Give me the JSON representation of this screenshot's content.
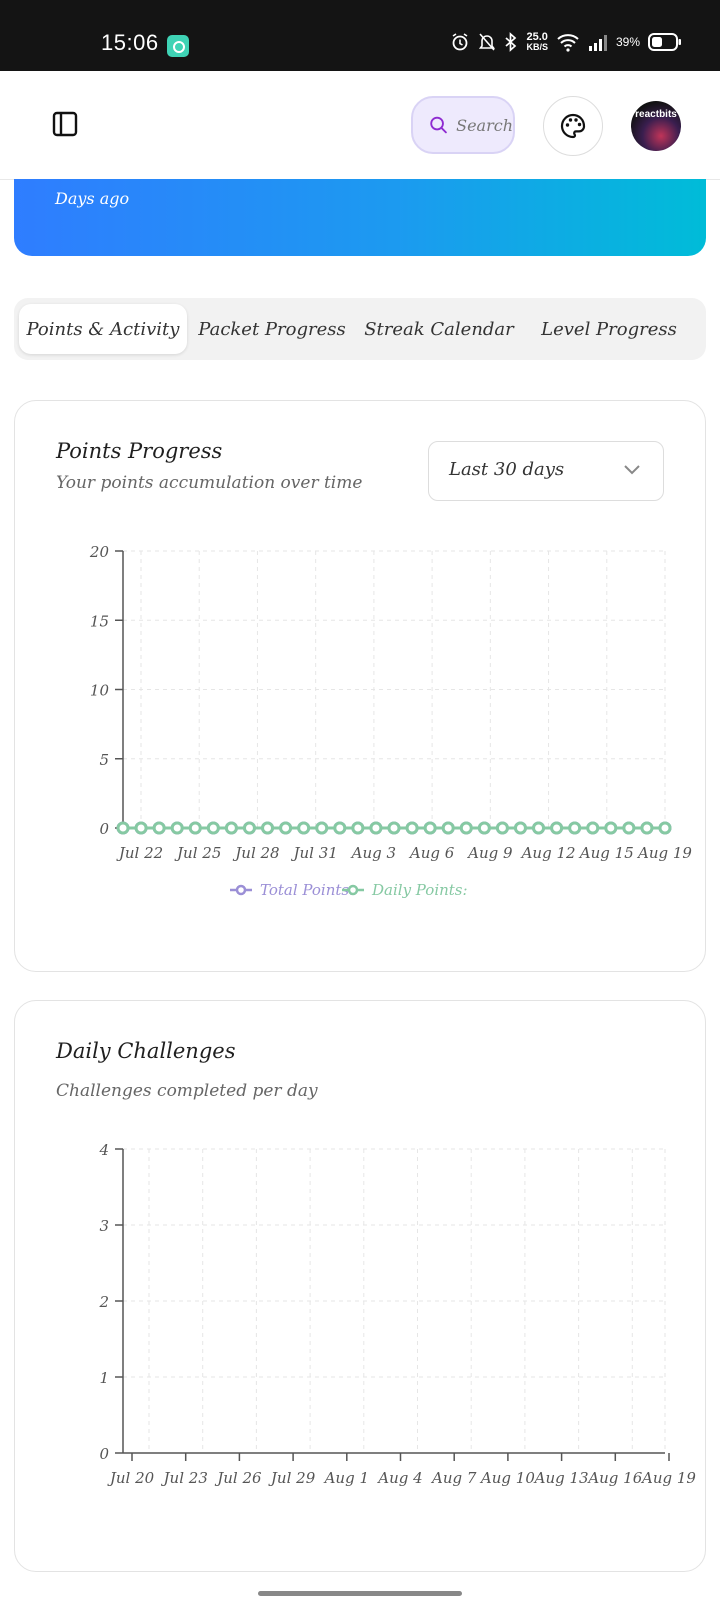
{
  "status_bar": {
    "time": "15:06",
    "net_speed_value": "25.0",
    "net_speed_unit": "KB/S",
    "battery": "39%"
  },
  "header": {
    "search_label": "Search",
    "avatar_text": "reactbits",
    "icons": [
      "sidebar-toggle-icon",
      "search-icon",
      "palette-icon"
    ]
  },
  "hero": {
    "subtitle": "Days ago"
  },
  "tabs": [
    {
      "label": "Points & Activity",
      "active": true
    },
    {
      "label": "Packet Progress",
      "active": false
    },
    {
      "label": "Streak Calendar",
      "active": false
    },
    {
      "label": "Level Progress",
      "active": false
    }
  ],
  "points_card": {
    "title": "Points Progress",
    "subtitle": "Your points accumulation over time",
    "range_select": "Last 30 days"
  },
  "challenges_card": {
    "title": "Daily Challenges",
    "subtitle": "Challenges completed per day"
  },
  "colors": {
    "total_points": "#9b8fd6",
    "daily_points": "#86c9a3",
    "axis": "#555555",
    "grid": "#e6e6e6",
    "hero_start": "#2f7dff",
    "hero_end": "#00bcd8"
  },
  "chart_data": [
    {
      "type": "line",
      "title": "Points Progress",
      "subtitle": "Your points accumulation over time",
      "x_ticks": [
        "Jul 22",
        "Jul 25",
        "Jul 28",
        "Jul 31",
        "Aug 3",
        "Aug 6",
        "Aug 9",
        "Aug 12",
        "Aug 15",
        "Aug 19"
      ],
      "y_ticks": [
        "0",
        "5",
        "10",
        "15",
        "20"
      ],
      "ylim": [
        0,
        20
      ],
      "point_count": 31,
      "series": [
        {
          "name": "Total Points:",
          "color": "#9b8fd6",
          "values": [
            0,
            0,
            0,
            0,
            0,
            0,
            0,
            0,
            0,
            0,
            0,
            0,
            0,
            0,
            0,
            0,
            0,
            0,
            0,
            0,
            0,
            0,
            0,
            0,
            0,
            0,
            0,
            0,
            0,
            0,
            0
          ]
        },
        {
          "name": "Daily Points:",
          "color": "#86c9a3",
          "values": [
            0,
            0,
            0,
            0,
            0,
            0,
            0,
            0,
            0,
            0,
            0,
            0,
            0,
            0,
            0,
            0,
            0,
            0,
            0,
            0,
            0,
            0,
            0,
            0,
            0,
            0,
            0,
            0,
            0,
            0,
            0
          ]
        }
      ],
      "grid": true,
      "legend": "bottom-center"
    },
    {
      "type": "bar",
      "title": "Daily Challenges",
      "subtitle": "Challenges completed per day",
      "x_ticks": [
        "Jul 20",
        "Jul 23",
        "Jul 26",
        "Jul 29",
        "Aug 1",
        "Aug 4",
        "Aug 7",
        "Aug 10",
        "Aug 13",
        "Aug 16",
        "Aug 19"
      ],
      "y_ticks": [
        "0",
        "1",
        "2",
        "3",
        "4"
      ],
      "ylim": [
        0,
        4
      ],
      "values": [],
      "grid": true
    }
  ]
}
